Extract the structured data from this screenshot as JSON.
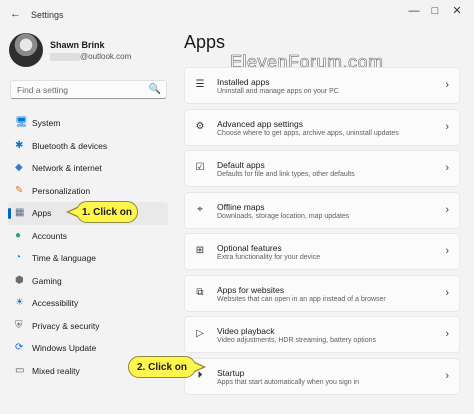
{
  "window": {
    "title": "Settings",
    "back_icon": "back-arrow-icon",
    "minimize": "—",
    "maximize": "□",
    "close": "✕"
  },
  "user": {
    "name": "Shawn Brink",
    "email": "@outlook.com"
  },
  "search": {
    "placeholder": "Find a setting",
    "icon": "🔍"
  },
  "nav": [
    {
      "label": "System",
      "icon": "🖥"
    },
    {
      "label": "Bluetooth & devices",
      "icon": "✱"
    },
    {
      "label": "Network & internet",
      "icon": "◆"
    },
    {
      "label": "Personalization",
      "icon": "✎"
    },
    {
      "label": "Apps",
      "icon": "▦"
    },
    {
      "label": "Accounts",
      "icon": "●"
    },
    {
      "label": "Time & language",
      "icon": "◔"
    },
    {
      "label": "Gaming",
      "icon": "⬢"
    },
    {
      "label": "Accessibility",
      "icon": "☀"
    },
    {
      "label": "Privacy & security",
      "icon": "⛨"
    },
    {
      "label": "Windows Update",
      "icon": "⟳"
    },
    {
      "label": "Mixed reality",
      "icon": "▭"
    }
  ],
  "main": {
    "title": "Apps",
    "watermark": "ElevenForum.com",
    "cards": [
      {
        "title": "Installed apps",
        "subtitle": "Uninstall and manage apps on your PC",
        "icon": "☰"
      },
      {
        "title": "Advanced app settings",
        "subtitle": "Choose where to get apps, archive apps, uninstall updates",
        "icon": "⚙"
      },
      {
        "title": "Default apps",
        "subtitle": "Defaults for file and link types, other defaults",
        "icon": "☑"
      },
      {
        "title": "Offline maps",
        "subtitle": "Downloads, storage location, map updates",
        "icon": "⌖"
      },
      {
        "title": "Optional features",
        "subtitle": "Extra functionality for your device",
        "icon": "⊞"
      },
      {
        "title": "Apps for websites",
        "subtitle": "Websites that can open in an app instead of a browser",
        "icon": "⧉"
      },
      {
        "title": "Video playback",
        "subtitle": "Video adjustments, HDR streaming, battery options",
        "icon": "▷"
      },
      {
        "title": "Startup",
        "subtitle": "Apps that start automatically when you sign in",
        "icon": "⏵"
      }
    ],
    "chevron": "›"
  },
  "callouts": {
    "first": "1. Click on",
    "second": "2. Click on"
  },
  "colors": {
    "accent": "#0067c0",
    "callout": "#fff64d"
  }
}
